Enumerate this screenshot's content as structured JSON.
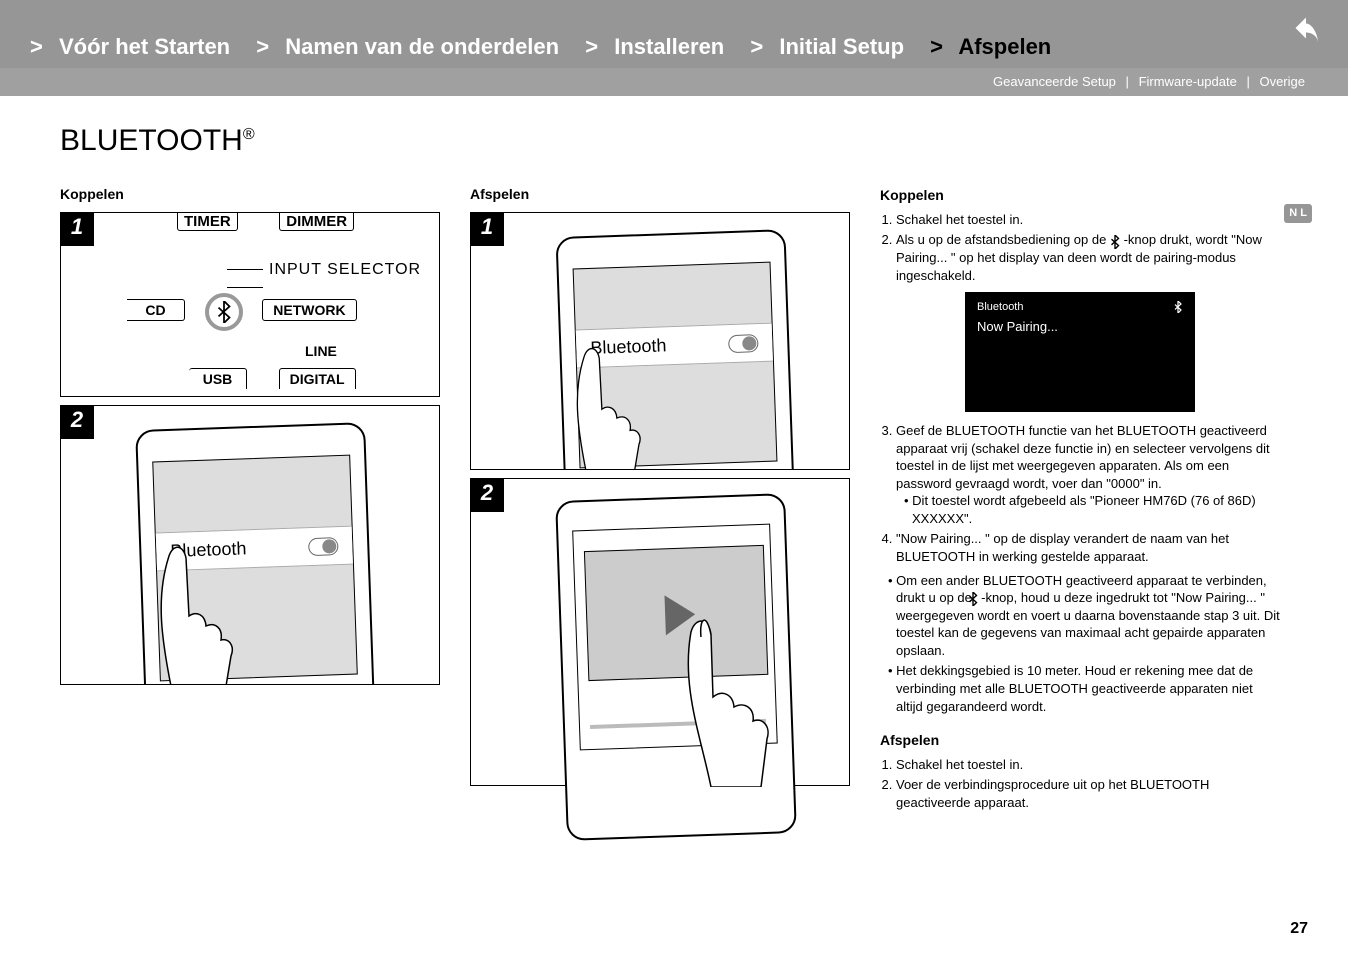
{
  "breadcrumb": {
    "items": [
      {
        "label": "Vóór het Starten",
        "active": false
      },
      {
        "label": "Namen van de onderdelen",
        "active": false
      },
      {
        "label": "Installeren",
        "active": false
      },
      {
        "label": "Initial Setup",
        "active": false
      },
      {
        "label": "Afspelen",
        "active": true
      }
    ],
    "prefix": ">"
  },
  "subnav": {
    "items": [
      "Geavanceerde Setup",
      "Firmware-update",
      "Overige"
    ],
    "sep": "|"
  },
  "title_main": "BLUETOOTH",
  "title_sup": "®",
  "col1_heading": "Koppelen",
  "col2_heading": "Afspelen",
  "remote": {
    "top_row": [
      "TIMER",
      "DIMMER"
    ],
    "title": "INPUT SELECTOR",
    "left1": "CD",
    "right1": "NETWORK",
    "right2": "LINE",
    "left2": "USB",
    "right3": "DIGITAL"
  },
  "phone_bt_label": "Bluetooth",
  "right": {
    "heading1": "Koppelen",
    "step1": "Schakel het toestel in.",
    "step2a": "Als u op de afstandsbediening op de ",
    "step2b": " -knop drukt, wordt \"Now Pairing... \" op het display van deen wordt de pairing-modus ingeschakeld.",
    "display_title": "Bluetooth",
    "display_status": "Now Pairing...",
    "step3": "Geef de BLUETOOTH functie van het BLUETOOTH geactiveerd apparaat vrij (schakel deze functie in) en selecteer vervolgens dit toestel in de lijst met weergegeven apparaten. Als om een password gevraagd wordt, voer dan \"0000\" in.",
    "step3_bullet": "Dit toestel wordt afgebeeld als \"Pioneer HM76D (76 of 86D) XXXXXX\".",
    "step4": "\"Now Pairing... \" op de display verandert de naam van het BLUETOOTH in werking gestelde apparaat.",
    "bullet2a": "Om een ander BLUETOOTH geactiveerd apparaat te verbinden, drukt u op de ",
    "bullet2b": "-knop, houd u deze ingedrukt tot \"Now Pairing... \" weergegeven wordt en voert u daarna bovenstaande stap 3 uit. Dit  toestel kan de gegevens van maximaal acht gepairde apparaten opslaan.",
    "bullet3": "Het dekkingsgebied is 10 meter. Houd er rekening mee dat de verbinding met alle BLUETOOTH geactiveerde apparaten niet altijd gegarandeerd wordt.",
    "heading2": "Afspelen",
    "play_step1": "Schakel het toestel in.",
    "play_step2": "Voer de verbindingsprocedure uit op het BLUETOOTH geactiveerde apparaat."
  },
  "side_tab": "N\nL",
  "page_num": "27",
  "steps": {
    "one": "1",
    "two": "2"
  }
}
